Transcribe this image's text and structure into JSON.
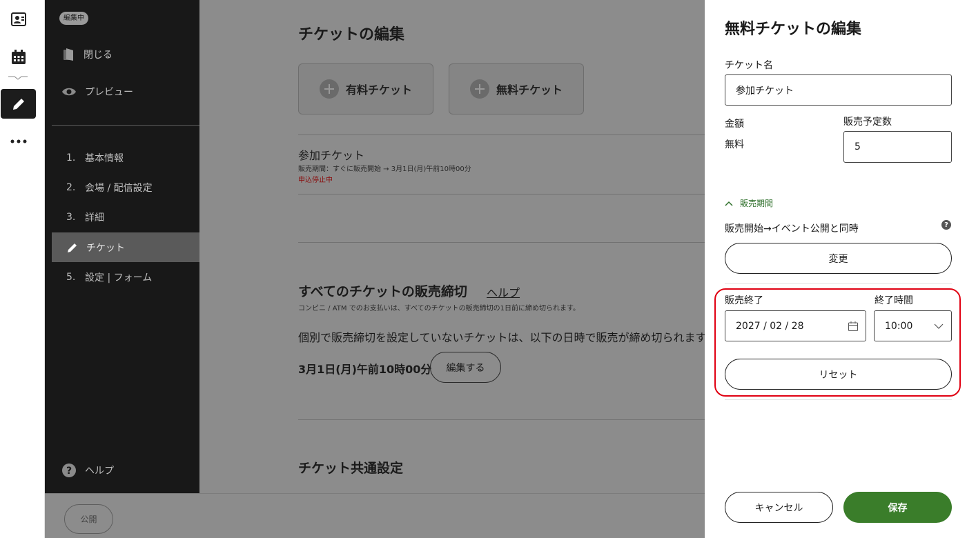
{
  "sidebar": {
    "badge": "編集中",
    "close_label": "閉じる",
    "preview_label": "プレビュー",
    "steps": [
      {
        "num": "1.",
        "label": "基本情報"
      },
      {
        "num": "2.",
        "label": "会場 / 配信設定"
      },
      {
        "num": "3.",
        "label": "詳細"
      },
      {
        "num": "",
        "label": "チケット"
      },
      {
        "num": "5.",
        "label": "設定 | フォーム"
      }
    ],
    "help_label": "ヘルプ"
  },
  "main": {
    "title": "チケットの編集",
    "add_paid_label": "有料チケット",
    "add_free_label": "無料チケット",
    "ticket": {
      "name": "参加チケット",
      "period": "販売期間：すぐに販売開始 → 3月1日(月)午前10時00分",
      "status": "申込停止中"
    },
    "deadline_section": {
      "title": "すべてのチケットの販売締切",
      "help_link": "ヘルプ",
      "note": "コンビニ / ATM でのお支払いは、すべてのチケットの販売締切の1日前に締め切られます。",
      "text": "個別で販売締切を設定していないチケットは、以下の日時で販売が締め切られます",
      "date": "3月1日(月)午前10時00分",
      "edit_label": "編集する"
    },
    "common_title": "チケット共通設定"
  },
  "bottombar": {
    "publish_label": "公開"
  },
  "panel": {
    "title": "無料チケットの編集",
    "ticket_name_label": "チケット名",
    "ticket_name_value": "参加チケット",
    "price_label": "金額",
    "price_value": "無料",
    "quantity_label": "販売予定数",
    "quantity_value": "5",
    "period_toggle_label": "販売期間",
    "sale_start_text": "販売開始→イベント公開と同時",
    "change_label": "変更",
    "sale_end_label": "販売終了",
    "sale_end_date": "2027 / 02 / 28",
    "end_time_label": "終了時間",
    "end_time_value": "10:00",
    "reset_label": "リセット",
    "cancel_label": "キャンセル",
    "save_label": "保存"
  },
  "colors": {
    "accent_green": "#3a7d2a",
    "highlight_red": "#e00012",
    "sidebar_bg": "#181818"
  }
}
